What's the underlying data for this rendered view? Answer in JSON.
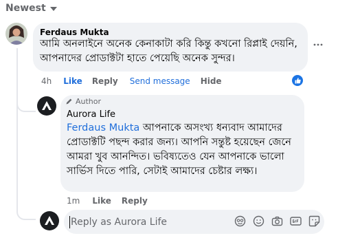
{
  "sort": {
    "label": "Newest"
  },
  "comment": {
    "author": "Ferdaus Mukta",
    "text": "আমি অনলাইনে অনেক কেনাকাটা করি কিন্তু কখনো রিপ্লাই দেয়নি, আপনাদের প্রোডাক্টটা হাতে পেয়েছি অনেক সুন্দর।",
    "time": "4h",
    "actions": {
      "like": "Like",
      "reply": "Reply",
      "send_message": "Send message",
      "hide": "Hide"
    },
    "reaction": "like"
  },
  "reply": {
    "badge": "Author",
    "author": "Aurora Life",
    "mention": "Ferdaus Mukta",
    "text": " আপনাকে অসংখ্য ধন্যবাদ আমাদের প্রোডাক্টটি পছন্দ করার জন্য। আপনি সন্তুষ্ট হয়েছেন জেনে আমরা খুব আনন্দিত। ভবিষ্যতেও যেন আপনাকে ভালো সার্ভিস দিতে পারি, সেটাই আমাদের চেষ্টার লক্ষ্য।",
    "time": "1m",
    "actions": {
      "like": "Like",
      "reply": "Reply"
    }
  },
  "composer": {
    "placeholder": "Reply as Aurora Life",
    "icons": [
      "avatar-sticker-icon",
      "emoji-icon",
      "camera-icon",
      "gif-icon",
      "sticker-icon"
    ]
  },
  "colors": {
    "accent": "#216fdb",
    "like_badge": "#1b74e4",
    "bubble": "#f0f2f5",
    "muted": "#65676b"
  }
}
